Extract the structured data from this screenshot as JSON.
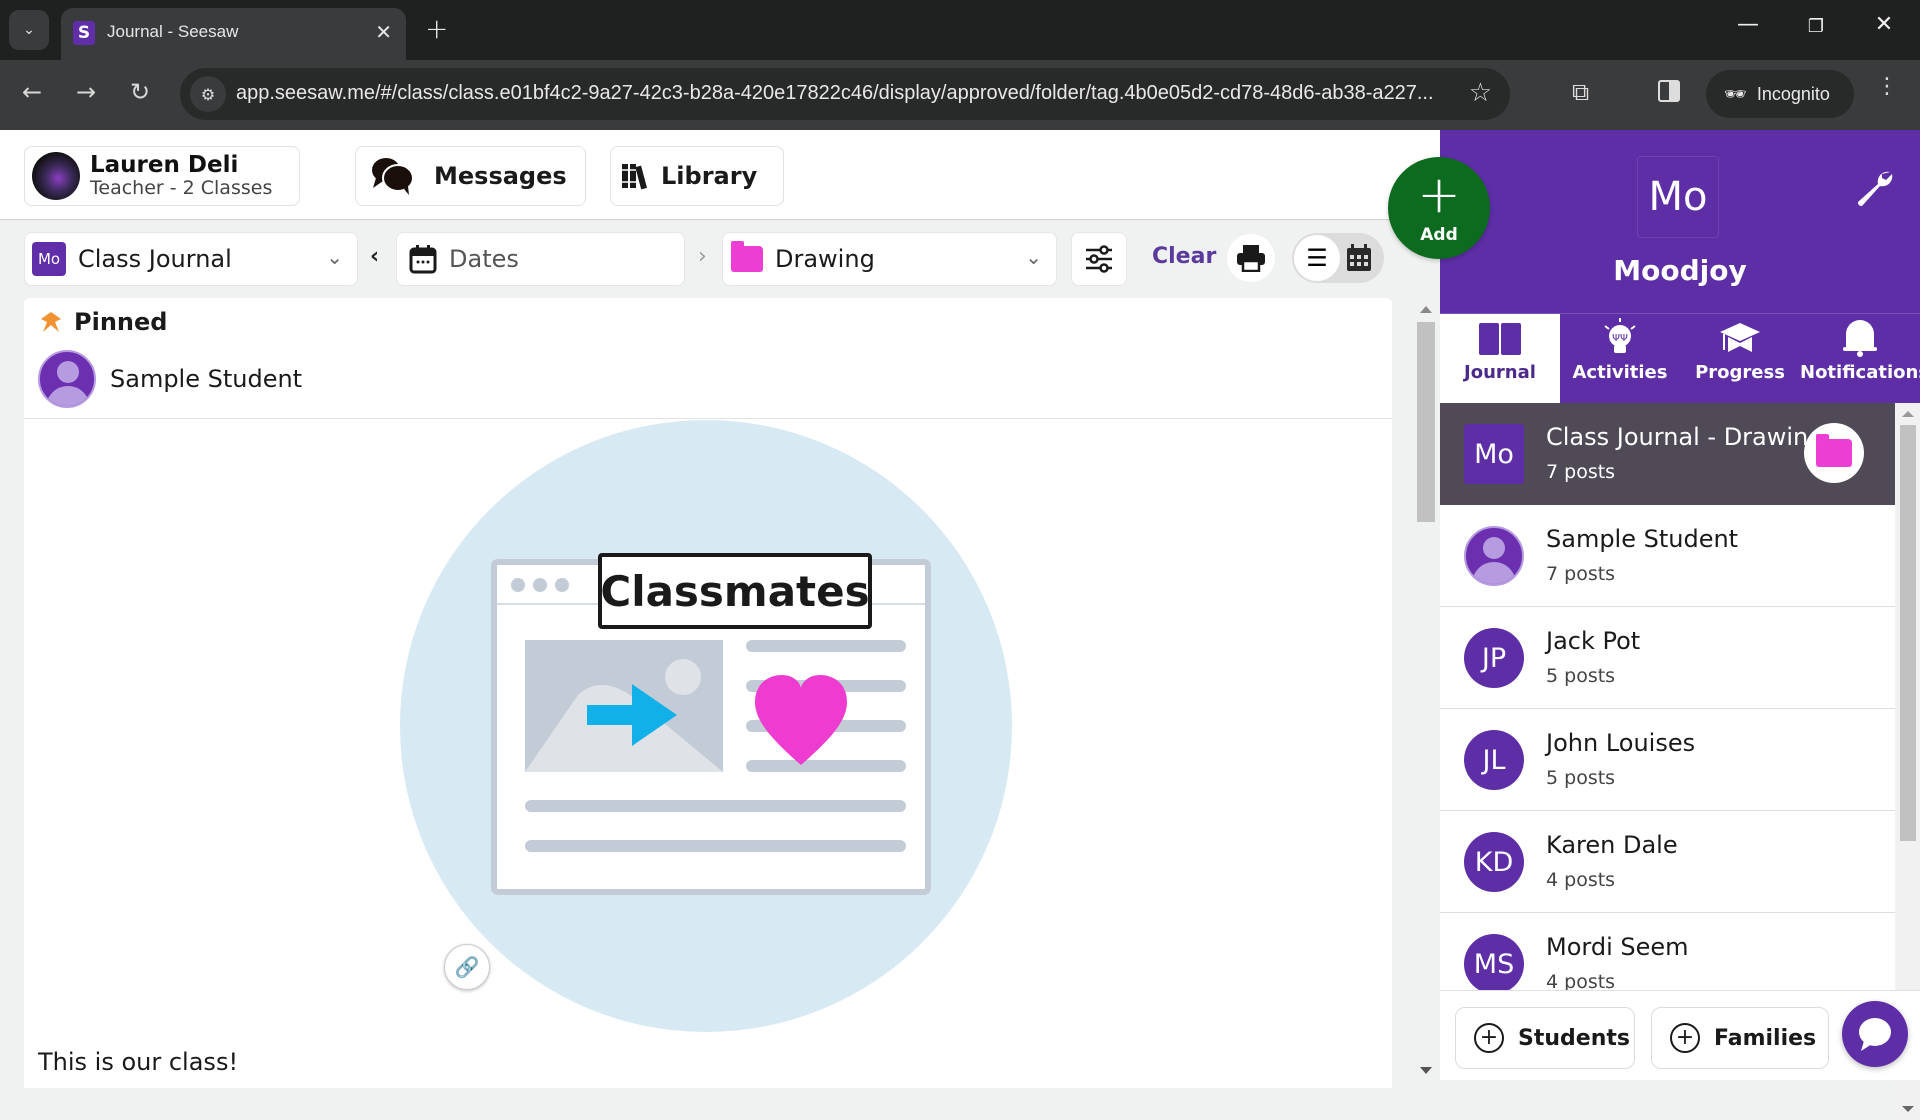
{
  "browser": {
    "tab_title": "Journal - Seesaw",
    "tab_favicon": "S",
    "url": "app.seesaw.me/#/class/class.e01bf4c2-9a27-42c3-b28a-420e17822c46/display/approved/folder/tag.4b0e05d2-cd78-48d6-ab38-a227...",
    "incognito_label": "Incognito"
  },
  "header": {
    "user_name": "Lauren Deli",
    "user_role": "Teacher - 2 Classes",
    "messages_label": "Messages",
    "library_label": "Library"
  },
  "filters": {
    "class_badge": "Mo",
    "class_value": "Class Journal",
    "dates_placeholder": "Dates",
    "folder_value": "Drawing",
    "clear_label": "Clear"
  },
  "add_button": {
    "label": "Add"
  },
  "post": {
    "pinned_label": "Pinned",
    "author": "Sample Student",
    "image_title": "Classmates",
    "caption": "This is our class!"
  },
  "class_panel": {
    "avatar": "Mo",
    "name": "Moodjoy",
    "tabs": [
      {
        "label": "Journal",
        "icon": "book-icon",
        "active": true
      },
      {
        "label": "Activities",
        "icon": "lightbulb-icon",
        "active": false
      },
      {
        "label": "Progress",
        "icon": "graduation-cap-icon",
        "active": false
      },
      {
        "label": "Notifications",
        "icon": "bell-icon",
        "active": false
      }
    ],
    "list": [
      {
        "avatar": "Mo",
        "name": "Class Journal    - Drawing",
        "count": "7 posts",
        "selected": true
      },
      {
        "avatar": "",
        "name": "Sample Student",
        "count": "7 posts"
      },
      {
        "avatar": "JP",
        "name": "Jack Pot",
        "count": "5 posts"
      },
      {
        "avatar": "JL",
        "name": "John Louises",
        "count": "5 posts"
      },
      {
        "avatar": "KD",
        "name": "Karen Dale",
        "count": "4 posts"
      },
      {
        "avatar": "MS",
        "name": "Mordi Seem",
        "count": "4 posts"
      }
    ],
    "footer": {
      "students_label": "Students",
      "families_label": "Families"
    }
  },
  "colors": {
    "brand_purple": "#5d2ea6",
    "add_green": "#0c6b1e",
    "folder_pink": "#ec3ed2",
    "selected_row": "#4f4a55"
  }
}
